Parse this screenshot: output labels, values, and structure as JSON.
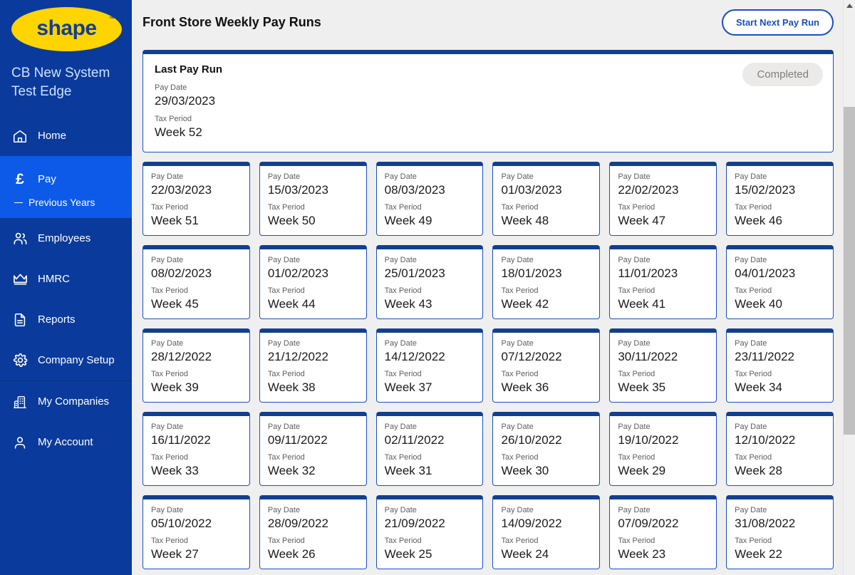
{
  "sidebar": {
    "logo": {
      "text": "shape",
      "tm": "™",
      "icon": "shape-logo"
    },
    "company_name": "CB New System Test Edge",
    "items": [
      {
        "label": "Home",
        "icon": "home-icon",
        "active": false
      },
      {
        "label": "Pay",
        "icon": "pound-icon",
        "active": true,
        "sub": "Previous Years"
      },
      {
        "label": "Employees",
        "icon": "people-icon",
        "active": false
      },
      {
        "label": "HMRC",
        "icon": "crown-icon",
        "active": false
      },
      {
        "label": "Reports",
        "icon": "document-icon",
        "active": false
      },
      {
        "label": "Company Setup",
        "icon": "gear-icon",
        "active": false
      },
      {
        "label": "My Companies",
        "icon": "building-icon",
        "active": false
      },
      {
        "label": "My Account",
        "icon": "person-icon",
        "active": false
      }
    ]
  },
  "header": {
    "title": "Front Store Weekly Pay Runs",
    "start_button": "Start Next Pay Run"
  },
  "last_pay_run": {
    "title": "Last Pay Run",
    "status": "Completed",
    "pay_date_label": "Pay Date",
    "pay_date": "29/03/2023",
    "tax_period_label": "Tax Period",
    "tax_period": "Week 52"
  },
  "labels": {
    "pay_date": "Pay Date",
    "tax_period": "Tax Period"
  },
  "pay_runs": [
    {
      "pay_date": "22/03/2023",
      "tax_period": "Week 51"
    },
    {
      "pay_date": "15/03/2023",
      "tax_period": "Week 50"
    },
    {
      "pay_date": "08/03/2023",
      "tax_period": "Week 49"
    },
    {
      "pay_date": "01/03/2023",
      "tax_period": "Week 48"
    },
    {
      "pay_date": "22/02/2023",
      "tax_period": "Week 47"
    },
    {
      "pay_date": "15/02/2023",
      "tax_period": "Week 46"
    },
    {
      "pay_date": "08/02/2023",
      "tax_period": "Week 45"
    },
    {
      "pay_date": "01/02/2023",
      "tax_period": "Week 44"
    },
    {
      "pay_date": "25/01/2023",
      "tax_period": "Week 43"
    },
    {
      "pay_date": "18/01/2023",
      "tax_period": "Week 42"
    },
    {
      "pay_date": "11/01/2023",
      "tax_period": "Week 41"
    },
    {
      "pay_date": "04/01/2023",
      "tax_period": "Week 40"
    },
    {
      "pay_date": "28/12/2022",
      "tax_period": "Week 39"
    },
    {
      "pay_date": "21/12/2022",
      "tax_period": "Week 38"
    },
    {
      "pay_date": "14/12/2022",
      "tax_period": "Week 37"
    },
    {
      "pay_date": "07/12/2022",
      "tax_period": "Week 36"
    },
    {
      "pay_date": "30/11/2022",
      "tax_period": "Week 35"
    },
    {
      "pay_date": "23/11/2022",
      "tax_period": "Week 34"
    },
    {
      "pay_date": "16/11/2022",
      "tax_period": "Week 33"
    },
    {
      "pay_date": "09/11/2022",
      "tax_period": "Week 32"
    },
    {
      "pay_date": "02/11/2022",
      "tax_period": "Week 31"
    },
    {
      "pay_date": "26/10/2022",
      "tax_period": "Week 30"
    },
    {
      "pay_date": "19/10/2022",
      "tax_period": "Week 29"
    },
    {
      "pay_date": "12/10/2022",
      "tax_period": "Week 28"
    },
    {
      "pay_date": "05/10/2022",
      "tax_period": "Week 27"
    },
    {
      "pay_date": "28/09/2022",
      "tax_period": "Week 26"
    },
    {
      "pay_date": "21/09/2022",
      "tax_period": "Week 25"
    },
    {
      "pay_date": "14/09/2022",
      "tax_period": "Week 24"
    },
    {
      "pay_date": "07/09/2022",
      "tax_period": "Week 23"
    },
    {
      "pay_date": "31/08/2022",
      "tax_period": "Week 22"
    }
  ],
  "colors": {
    "brand_blue": "#0a3b9c",
    "active_blue": "#0d5ae8",
    "card_border": "#123f8f",
    "logo_yellow": "#ffd400",
    "badge_grey": "#eceae8",
    "page_bg": "#efefef"
  }
}
